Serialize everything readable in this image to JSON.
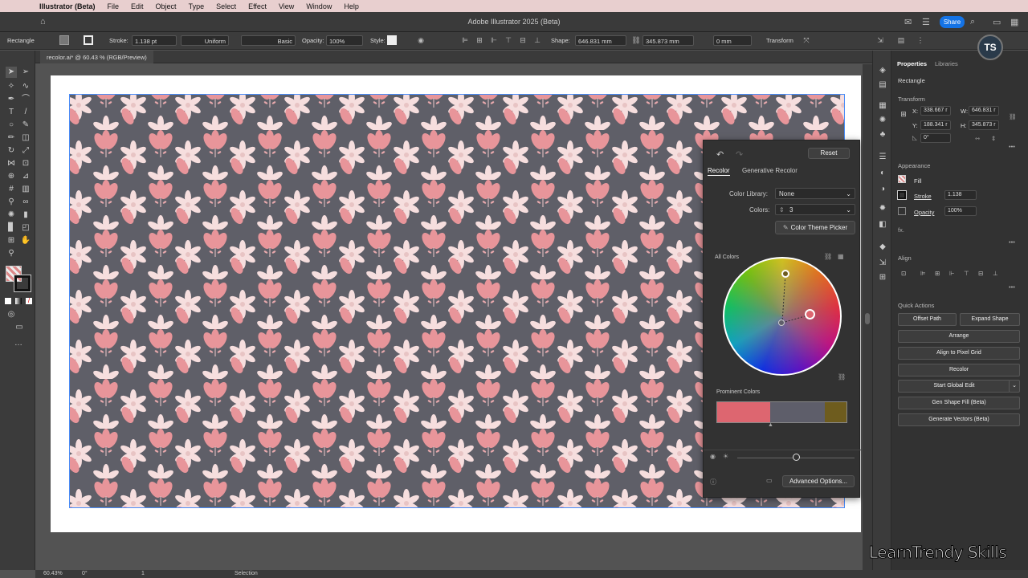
{
  "menubar": {
    "app_name": "Illustrator (Beta)",
    "items": [
      "File",
      "Edit",
      "Object",
      "Type",
      "Select",
      "Effect",
      "View",
      "Window",
      "Help"
    ]
  },
  "titlebar": {
    "title": "Adobe Illustrator 2025 (Beta)",
    "share_label": "Share"
  },
  "controlbar": {
    "object_type": "Rectangle",
    "stroke_label": "Stroke:",
    "stroke_value": "1.138 pt",
    "stroke_profile": "Uniform",
    "brush": "Basic",
    "opacity_label": "Opacity:",
    "opacity_value": "100%",
    "style_label": "Style:",
    "shape_label": "Shape:",
    "width_value": "646.831 mm",
    "height_value": "345.873 mm",
    "corner_value": "0 mm",
    "transform_label": "Transform"
  },
  "document": {
    "tab_label": "recolor.ai* @ 60.43 % (RGB/Preview)"
  },
  "recolor_panel": {
    "reset_label": "Reset",
    "tab_recolor": "Recolor",
    "tab_generative": "Generative Recolor",
    "color_library_label": "Color Library:",
    "color_library_value": "None",
    "colors_label": "Colors:",
    "colors_value": "3",
    "theme_picker_label": "Color Theme Picker",
    "all_colors_label": "All Colors",
    "prominent_label": "Prominent Colors",
    "prominent_colors": [
      {
        "color": "#dd6670",
        "share": 0.41
      },
      {
        "color": "#5e5e6a",
        "share": 0.42
      },
      {
        "color": "#6e5c1e",
        "share": 0.17
      }
    ],
    "advanced_label": "Advanced Options...",
    "brightness": 0.5
  },
  "properties": {
    "tab_properties": "Properties",
    "tab_libraries": "Libraries",
    "object_type": "Rectangle",
    "transform_heading": "Transform",
    "x_label": "X:",
    "x_value": "338.667 r",
    "w_label": "W:",
    "w_value": "646.831 r",
    "y_label": "Y:",
    "y_value": "188.341 r",
    "h_label": "H:",
    "h_value": "345.873 r",
    "rotation_value": "0°",
    "appearance_heading": "Appearance",
    "fill_label": "Fill",
    "stroke_label": "Stroke",
    "stroke_value": "1.138",
    "opacity_label": "Opacity",
    "opacity_value": "100%",
    "fx_label": "fx.",
    "align_heading": "Align",
    "quick_actions_heading": "Quick Actions",
    "offset_path": "Offset Path",
    "expand_shape": "Expand Shape",
    "arrange": "Arrange",
    "align_pixel": "Align to Pixel Grid",
    "recolor": "Recolor",
    "start_global_edit": "Start Global Edit",
    "gen_shape_fill": "Gen Shape Fill (Beta)",
    "generate_vectors": "Generate Vectors (Beta)"
  },
  "statusbar": {
    "zoom": "60.43%",
    "rotation": "0°",
    "artboard": "1",
    "tool": "Selection"
  },
  "watermark": "LearnTrendy Skills",
  "logo_text": "TS",
  "colors": {
    "pattern_bg": "#5f5f68",
    "leaf_pink": "#e8959a",
    "flower_light": "#f6dede",
    "accent_blue": "#1473e6"
  }
}
